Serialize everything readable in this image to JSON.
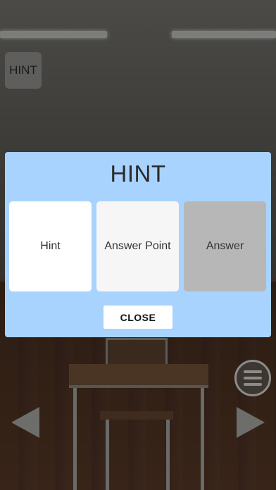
{
  "hud": {
    "hint_button_label": "HINT"
  },
  "dialog": {
    "title": "HINT",
    "options": [
      {
        "label": "Hint"
      },
      {
        "label": "Answer Point"
      },
      {
        "label": "Answer"
      }
    ],
    "close_label": "CLOSE"
  },
  "colors": {
    "dialog_bg": "#a9d3ff",
    "option_answer_bg": "#b7b7b7",
    "overlay_dim": "rgba(0,0,0,0.5)"
  },
  "icons": {
    "menu": "hamburger-menu-icon",
    "left": "arrow-left-icon",
    "right": "arrow-right-icon"
  }
}
